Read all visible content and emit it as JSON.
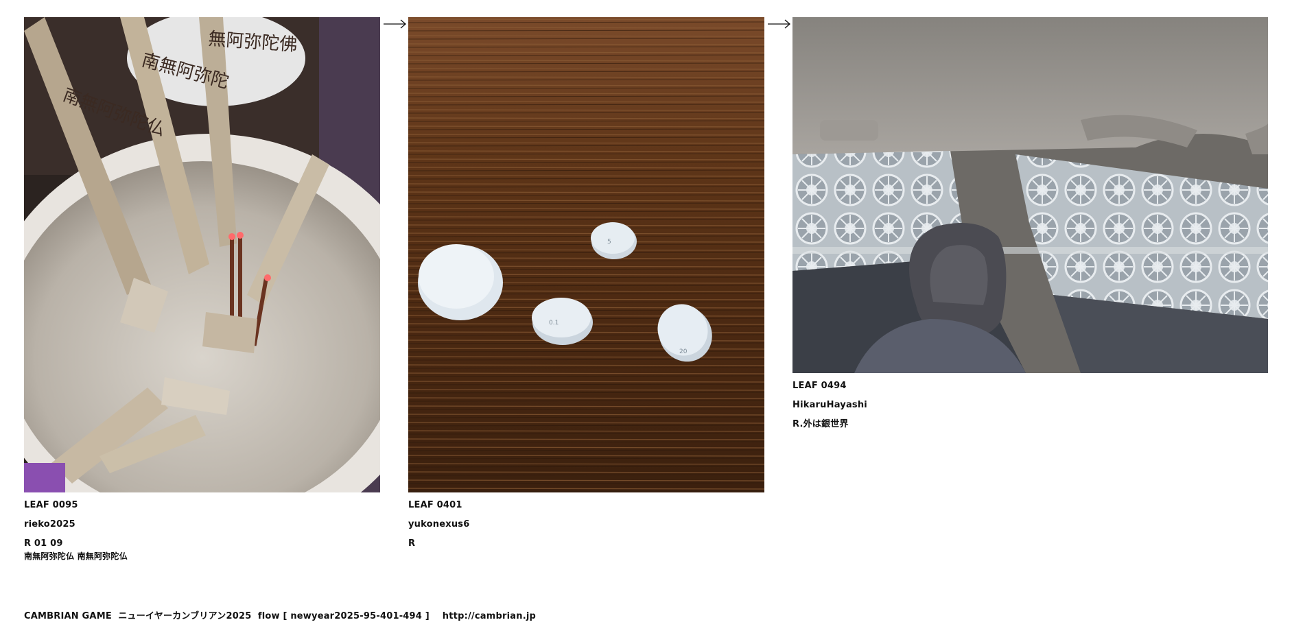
{
  "leaves": [
    {
      "id_label": "LEAF 0095",
      "user": "rieko2025",
      "reply": "R 01 09",
      "note": "南無阿弥陀仏 南無阿弥陀仏",
      "image_subject": "incense-burner-with-sotoba-sticks"
    },
    {
      "id_label": "LEAF 0401",
      "user": "yukonexus6",
      "reply": "R",
      "note": "",
      "image_subject": "white-pills-on-wooden-table"
    },
    {
      "id_label": "LEAF 0494",
      "user": "HikaruHayashi",
      "reply": "R.外は銀世界",
      "note": "",
      "image_subject": "car-interior-with-wheel-display-outside"
    }
  ],
  "arrows": [
    "arrow-right-icon",
    "arrow-right-icon"
  ],
  "footer": {
    "text": "CAMBRIAN GAME  ニューイヤーカンブリアン2025  flow [ newyear2025-95-401-494 ]    http://cambrian.jp"
  }
}
